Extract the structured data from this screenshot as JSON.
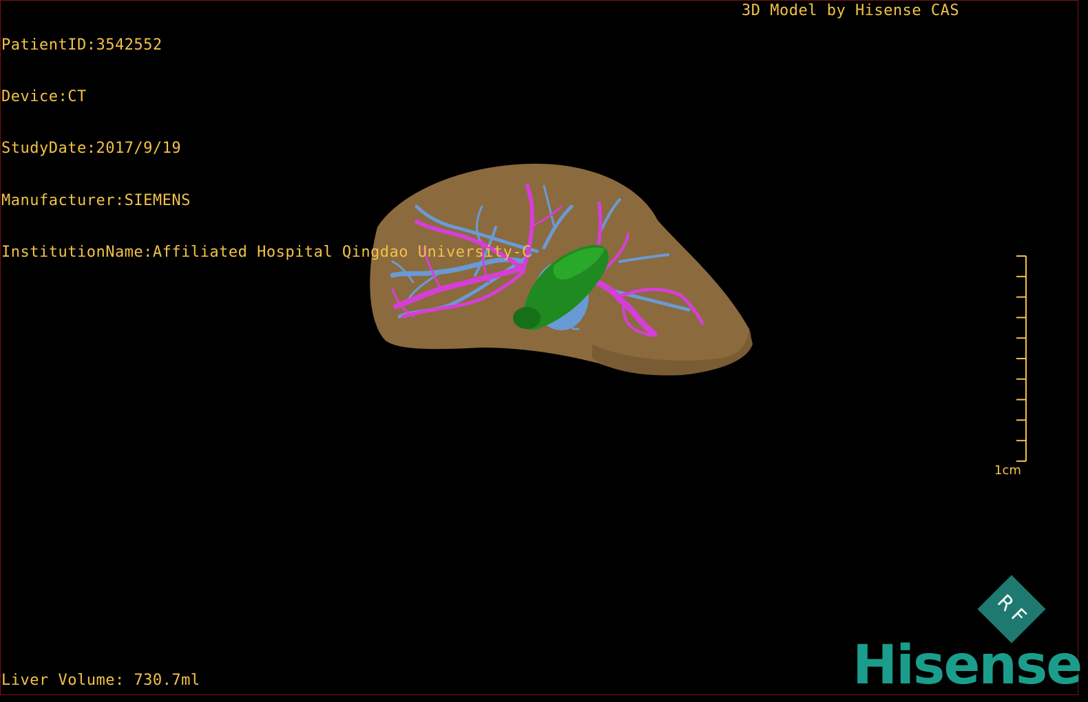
{
  "dicom_info": {
    "patient_id": "PatientID:3542552",
    "device": "Device:CT",
    "study_date": "StudyDate:2017/9/19",
    "manufacturer": "Manufacturer:SIEMENS",
    "institution": "InstitutionName:Affiliated Hospital Qingdao University-C"
  },
  "header": {
    "title": "3D Model by Hisense CAS"
  },
  "footer": {
    "liver_volume": "Liver Volume: 730.7ml"
  },
  "scale_bar": {
    "label": "1cm"
  },
  "badge": {
    "text": "R F"
  },
  "brand": {
    "name": "Hisense"
  },
  "colors": {
    "text": "#f2c24a",
    "liver": "#8b6a3e",
    "portal_vein": "#d53fd6",
    "hepatic_vein": "#6a9ad6",
    "tumor": "#1f8a1f",
    "brand": "#1b9d8c"
  }
}
